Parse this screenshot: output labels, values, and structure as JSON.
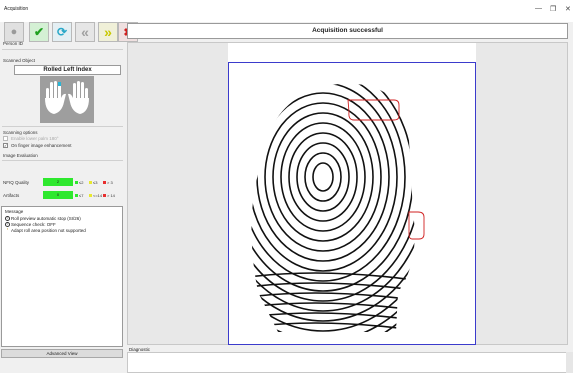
{
  "window": {
    "title": "Acquisition",
    "controls": [
      "—",
      "❐",
      "✕"
    ]
  },
  "toolbar": {
    "buttons": [
      {
        "name": "record",
        "glyph": "●",
        "color": "#9a9a9a",
        "bg": "#e0e0e0"
      },
      {
        "name": "accept",
        "glyph": "✔",
        "color": "#20a020",
        "bg": "#d4f0d4"
      },
      {
        "name": "refresh",
        "glyph": "⟳",
        "color": "#2aa8c8",
        "bg": "#e4eff3"
      },
      {
        "name": "back",
        "glyph": "«",
        "color": "#a0a0a0",
        "bg": "#e6e6e6"
      },
      {
        "name": "forward",
        "glyph": "»",
        "color": "#c8c800",
        "bg": "#f0f0d8"
      },
      {
        "name": "cancel",
        "glyph": "✖",
        "color": "#d02020",
        "bg": "#efe0e0"
      }
    ]
  },
  "status": {
    "text": "Acquisition successful"
  },
  "left": {
    "person_id_label": "Person ID",
    "scanned_object_label": "Scanned Object",
    "scanned_object_value": "Rolled Left Index",
    "scanning_options_label": "Scanning options",
    "option1": "Enable lower palm 180°",
    "option2": "On finger image enhancement",
    "image_eval_label": "Image Evaluation",
    "nfiq_label": "NFIQ Quality",
    "nfiq_value": "2",
    "nfiq_legend": [
      "≤2",
      "≤3",
      "> 3"
    ],
    "artifacts_label": "Artifacts",
    "artifacts_value": "0",
    "artifacts_legend": [
      "≤7",
      "<=14",
      "> 14"
    ],
    "message_label": "Message",
    "messages": [
      {
        "text": "Roll preview automatic stop (SI/26)",
        "icon": "i"
      },
      {
        "text": "Sequence check: OFF",
        "icon": "i"
      },
      {
        "text": "Adapt roll area position not supported",
        "icon": "!"
      }
    ],
    "advanced_view": "Advanced View"
  },
  "diagnostic_label": "Diagnostic",
  "colors": {
    "good": "#2ee82e",
    "warn": "#e8e82e",
    "bad": "#e82e2e",
    "frame": "#3b3bcc",
    "highlight": "#d02020"
  }
}
